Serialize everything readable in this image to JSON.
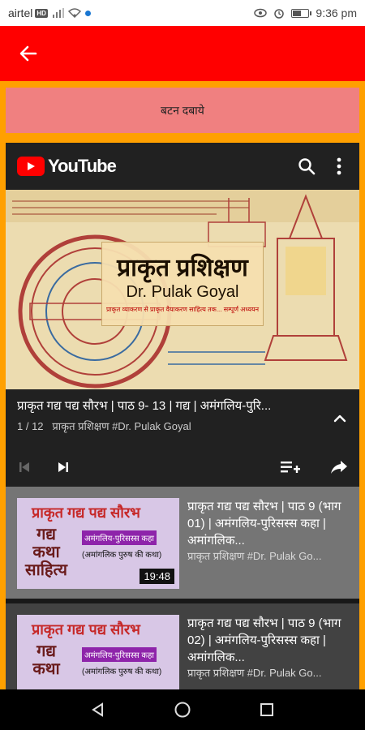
{
  "status_bar": {
    "carrier": "airtel",
    "carrier_badge": "HD",
    "time": "9:36 pm",
    "battery_level": 0.5
  },
  "app_bar": {
    "color": "#ff0000"
  },
  "button": {
    "label": "बटन दबाये",
    "color": "#f08080"
  },
  "player": {
    "brand": "YouTube",
    "thumbnail": {
      "title_hindi": "प्राकृत प्रशिक्षण",
      "title_english": "Dr. Pulak Goyal",
      "subtitle": "प्राकृत व्याकरण से प्राकृत वैयाकरण साहित्य तक... सम्पूर्ण अध्ययन"
    },
    "current_title": "प्राकृत गद्य पद्य सौरभ | पाठ 9- 13 | गद्य | अमंगलिय-पुरि...",
    "position": "1 / 12",
    "channel": "प्राकृत प्रशिक्षण #Dr. Pulak Goyal"
  },
  "playlist": [
    {
      "thumb_title": "प्राकृत गद्य पद्य सौरभ",
      "thumb_left": "गद्य कथा साहित्य",
      "thumb_tag": "अमंगलिय-पुरिसस्स कहा",
      "thumb_sub": "(अमांगलिक पुरुष की कथा)",
      "duration": "19:48",
      "title": "प्राकृत गद्य पद्य सौरभ | पाठ 9 (भाग 01) | अमंगलिय-पुरिसस्स कहा | अमांगलिक...",
      "channel": "प्राकृत प्रशिक्षण #Dr. Pulak Go..."
    },
    {
      "thumb_title": "प्राकृत गद्य पद्य सौरभ",
      "thumb_left": "गद्य कथा",
      "thumb_tag": "अमंगलिय-पुरिसस्स कहा",
      "thumb_sub": "(अमांगलिक पुरुष की कथा)",
      "duration": "",
      "title": "प्राकृत गद्य पद्य सौरभ | पाठ 9 (भाग 02) | अमंगलिय-पुरिसस्स कहा | अमांगलिक...",
      "channel": "प्राकृत प्रशिक्षण #Dr. Pulak Go..."
    }
  ],
  "accent_orange": "#ffa000"
}
